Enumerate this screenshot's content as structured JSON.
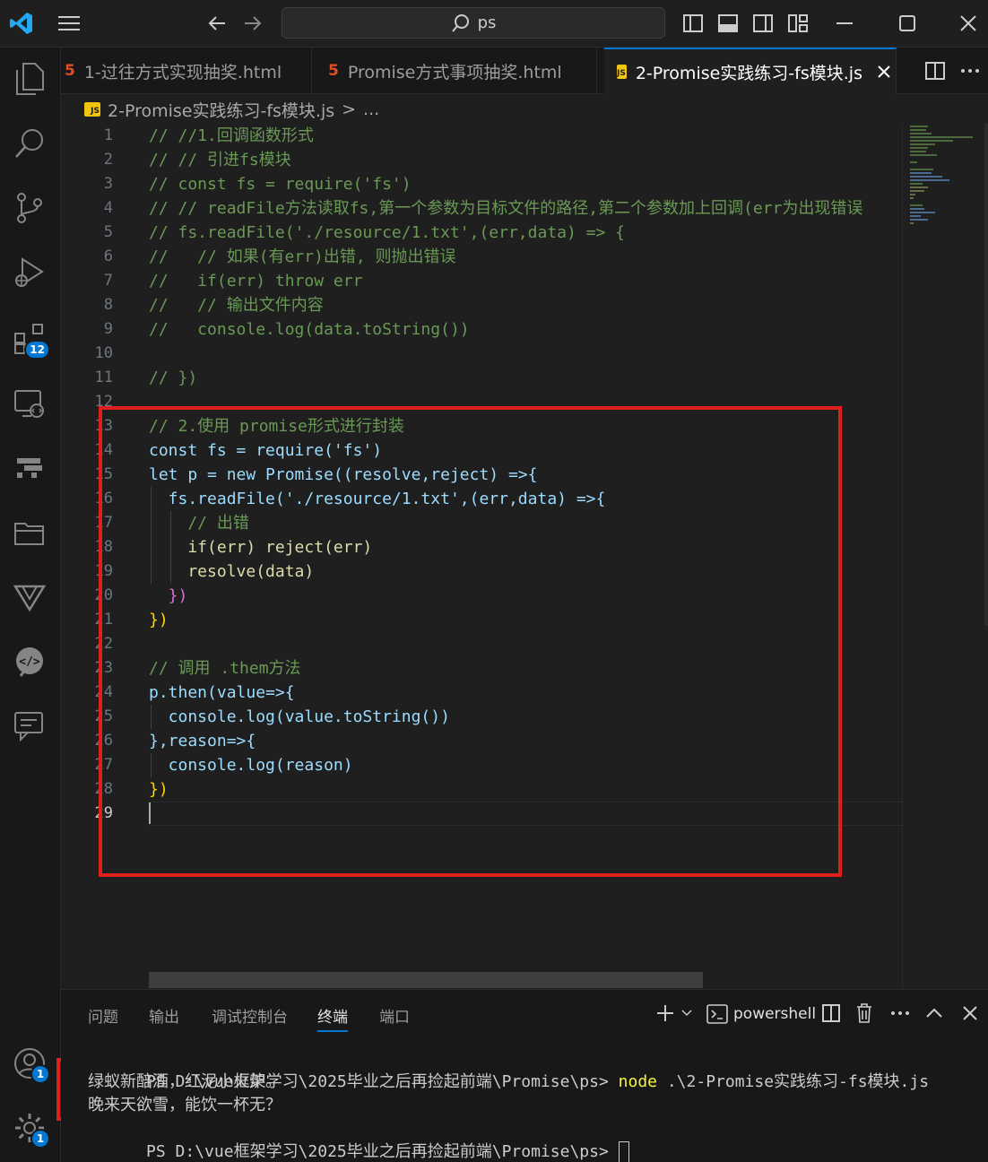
{
  "titlebar": {
    "search_text": "ps"
  },
  "activity": {
    "extensions_badge": "12",
    "accounts_badge": "1",
    "manage_badge": "1"
  },
  "tabs": [
    {
      "label": "1-过往方式实现抽奖.html",
      "icon": "html-file-icon"
    },
    {
      "label": "Promise方式事项抽奖.html",
      "icon": "html-file-icon"
    },
    {
      "label": "2-Promise实践练习-fs模块.js",
      "icon": "js-file-icon",
      "active": true
    }
  ],
  "breadcrumb": {
    "file": "2-Promise实践练习-fs模块.js",
    "separator": ">",
    "rest": "..."
  },
  "editor": {
    "line_numbers": [
      "1",
      "2",
      "3",
      "4",
      "5",
      "6",
      "7",
      "8",
      "9",
      "10",
      "11",
      "12",
      "13",
      "14",
      "15",
      "16",
      "17",
      "18",
      "19",
      "20",
      "21",
      "22",
      "23",
      "24",
      "25",
      "26",
      "27",
      "28",
      "29"
    ],
    "current_line": "29",
    "lines": [
      "// //1.回调函数形式",
      "// // 引进fs模块",
      "// const fs = require('fs')",
      "// // readFile方法读取fs,第一个参数为目标文件的路径,第二个参数加上回调(err为出现错误",
      "// fs.readFile('./resource/1.txt',(err,data) => {",
      "//   // 如果(有err)出错, 则抛出错误",
      "//   if(err) throw err",
      "//   // 输出文件内容",
      "//   console.log(data.toString())",
      "",
      "// })",
      "",
      "// 2.使用 promise形式进行封装",
      "const fs = require('fs')",
      "let p = new Promise((resolve,reject) =>{",
      "  fs.readFile('./resource/1.txt',(err,data) =>{",
      "    // 出错",
      "    if(err) reject(err)",
      "    resolve(data)",
      "  })",
      "})",
      "",
      "// 调用 .them方法",
      "p.then(value=>{",
      "  console.log(value.toString())",
      "},reason=>{",
      "  console.log(reason)",
      "})",
      ""
    ]
  },
  "panel": {
    "tabs": [
      "问题",
      "输出",
      "调试控制台",
      "终端",
      "端口"
    ],
    "active_tab": "终端",
    "shell_label": "powershell",
    "terminal": {
      "prompt": "PS D:\\vue框架学习\\2025毕业之后再捡起前端\\Promise\\ps>",
      "command_word": "node",
      "command_arg": ".\\2-Promise实践练习-fs模块.js",
      "output_1": "绿蚁新醅酒，红泥小火炉。",
      "output_2": "晚来天欲雪，能饮一杯无？"
    }
  },
  "colors": {
    "accent": "#0078d4",
    "highlight_box": "#e01e1e"
  }
}
